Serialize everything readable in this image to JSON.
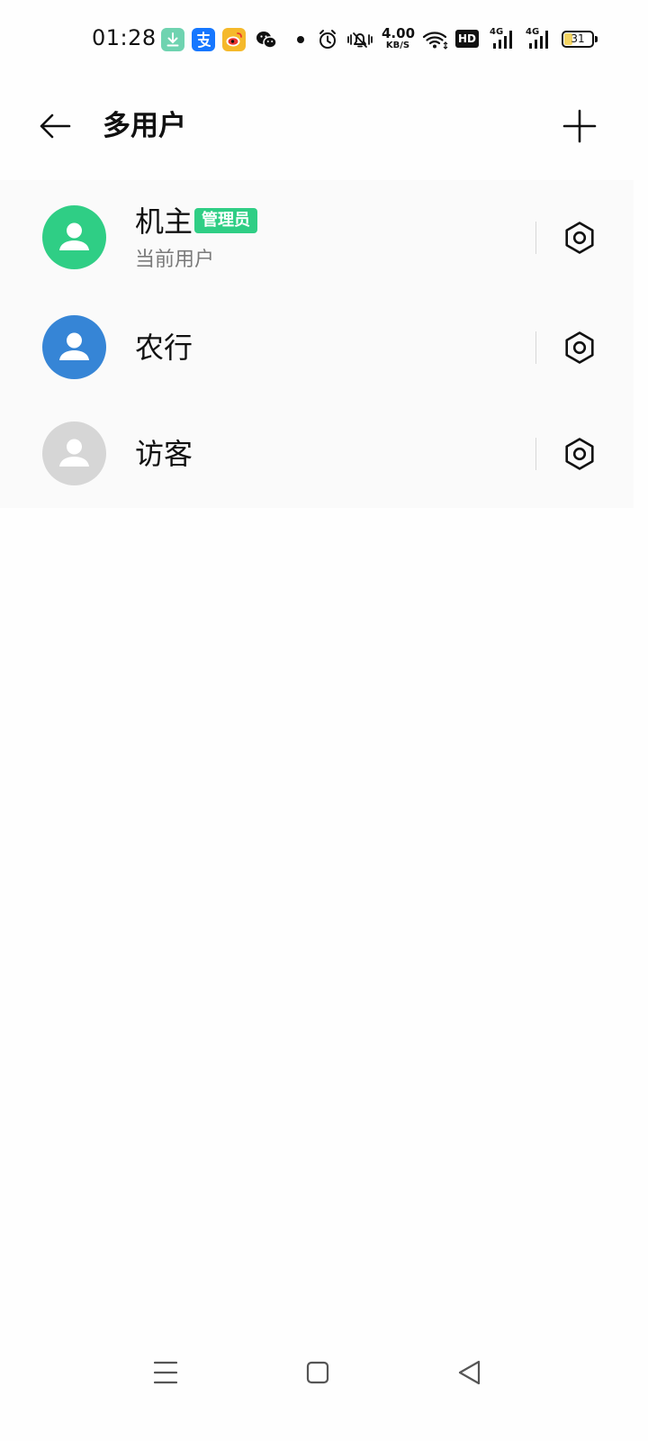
{
  "status_bar": {
    "time": "01:28",
    "net_speed_value": "4.00",
    "net_speed_unit": "KB/S",
    "hd_label": "HD",
    "sim1_label": "4G",
    "sim2_label": "4G",
    "battery_level": "31",
    "icons": [
      "download-app-icon",
      "alipay-icon",
      "weibo-icon",
      "wechat-icon",
      "dot-icon",
      "alarm-icon",
      "mute-icon",
      "wifi-icon",
      "signal-icon",
      "battery-icon"
    ]
  },
  "header": {
    "title": "多用户",
    "back_icon": "arrow-left-icon",
    "add_icon": "plus-icon"
  },
  "users": [
    {
      "name": "机主",
      "badge": "管理员",
      "subtitle": "当前用户",
      "avatar_color": "#2fce85"
    },
    {
      "name": "农行",
      "avatar_color": "#3685d6"
    },
    {
      "name": "访客",
      "avatar_color": "#d6d6d6"
    }
  ],
  "nav_bar": {
    "icons": [
      "menu-icon",
      "home-icon",
      "back-triangle-icon"
    ]
  },
  "colors": {
    "admin_badge": "#2fce85",
    "background": "#fefefe",
    "list_background": "#fafafa"
  }
}
